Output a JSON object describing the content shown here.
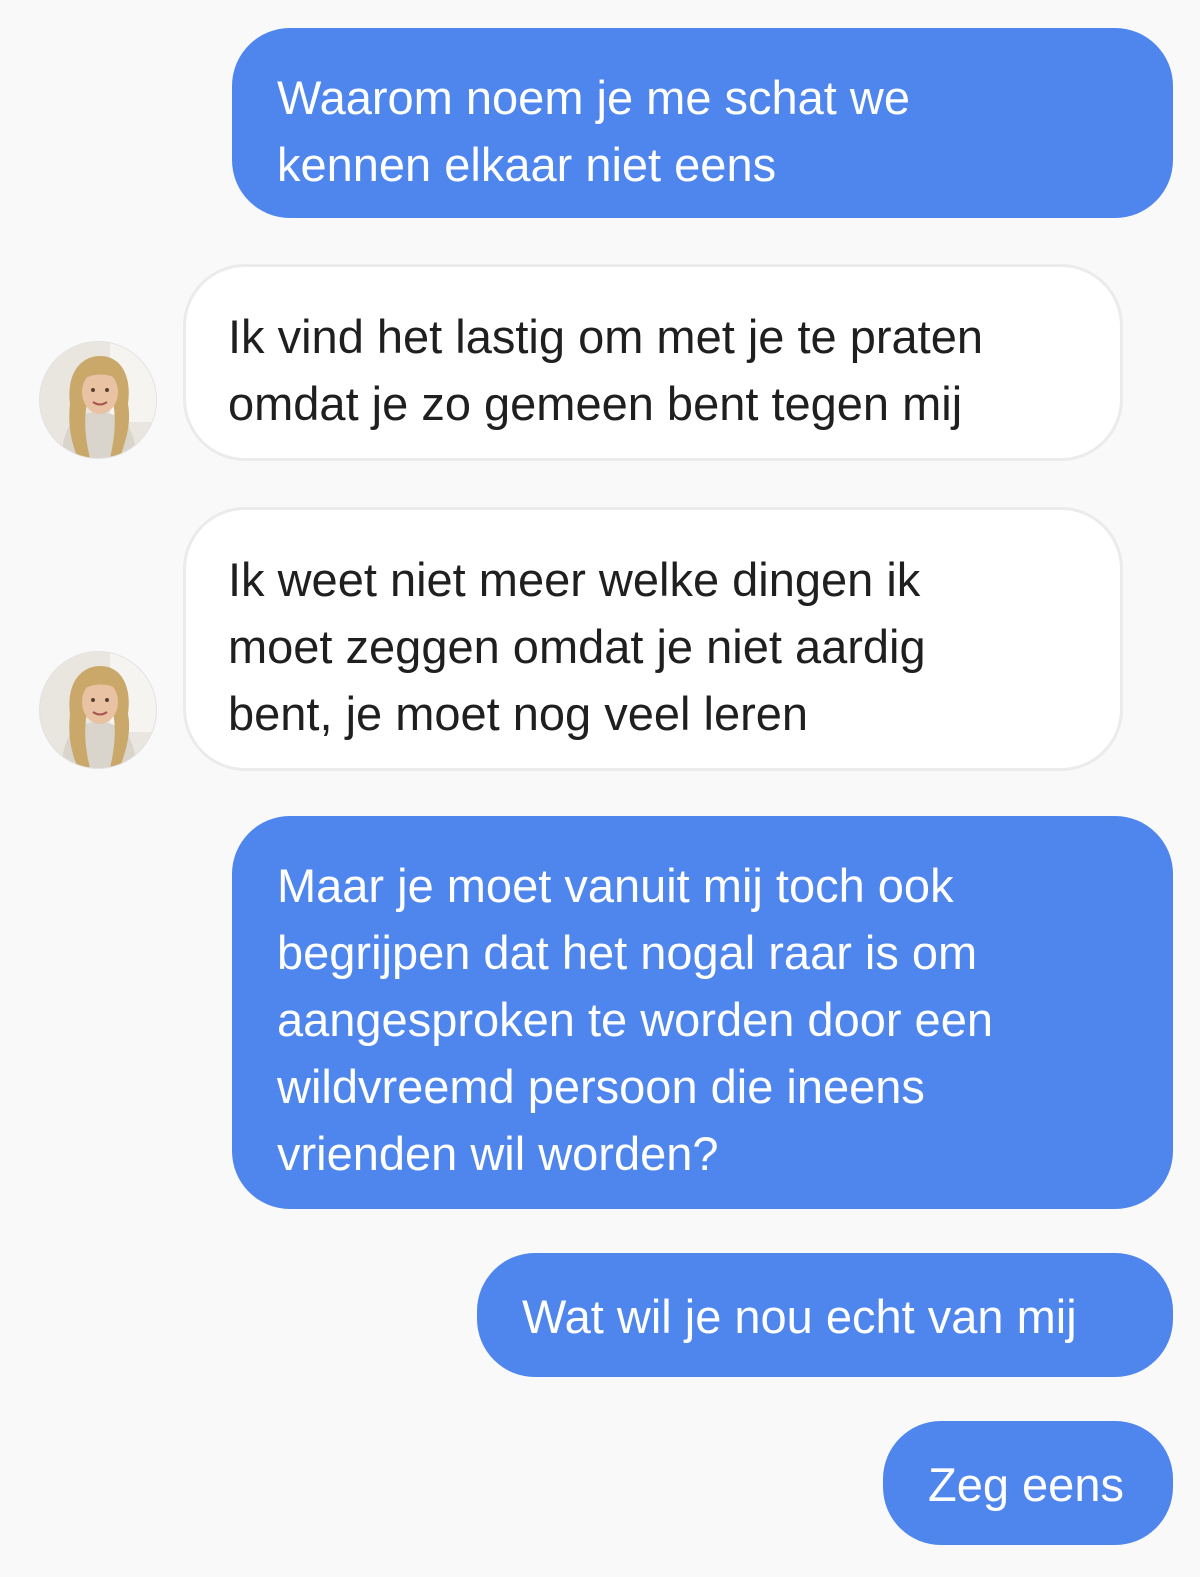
{
  "conversation": {
    "messages": [
      {
        "sender": "me",
        "text": "Waarom noem je me schat we\nkennen elkaar niet eens"
      },
      {
        "sender": "contact",
        "text": "Ik vind het lastig om met je te praten\nomdat je zo gemeen bent tegen mij"
      },
      {
        "sender": "contact",
        "text": "Ik weet niet meer welke dingen ik\nmoet zeggen omdat je niet aardig\nbent, je moet nog veel leren"
      },
      {
        "sender": "me",
        "text": "Maar je moet vanuit mij toch ook\nbegrijpen dat het nogal raar is om\naangesproken te worden door een\nwildvreemd persoon die ineens\nvrienden wil worden?"
      },
      {
        "sender": "me",
        "text": "Wat wil je nou echt van mij"
      },
      {
        "sender": "me",
        "text": "Zeg eens"
      }
    ]
  },
  "colors": {
    "sent_bubble": "#4f86ee",
    "received_bubble": "#ffffff",
    "background": "#f9f9f9"
  },
  "icons": {
    "contact_avatar": "contact-avatar-photo"
  }
}
